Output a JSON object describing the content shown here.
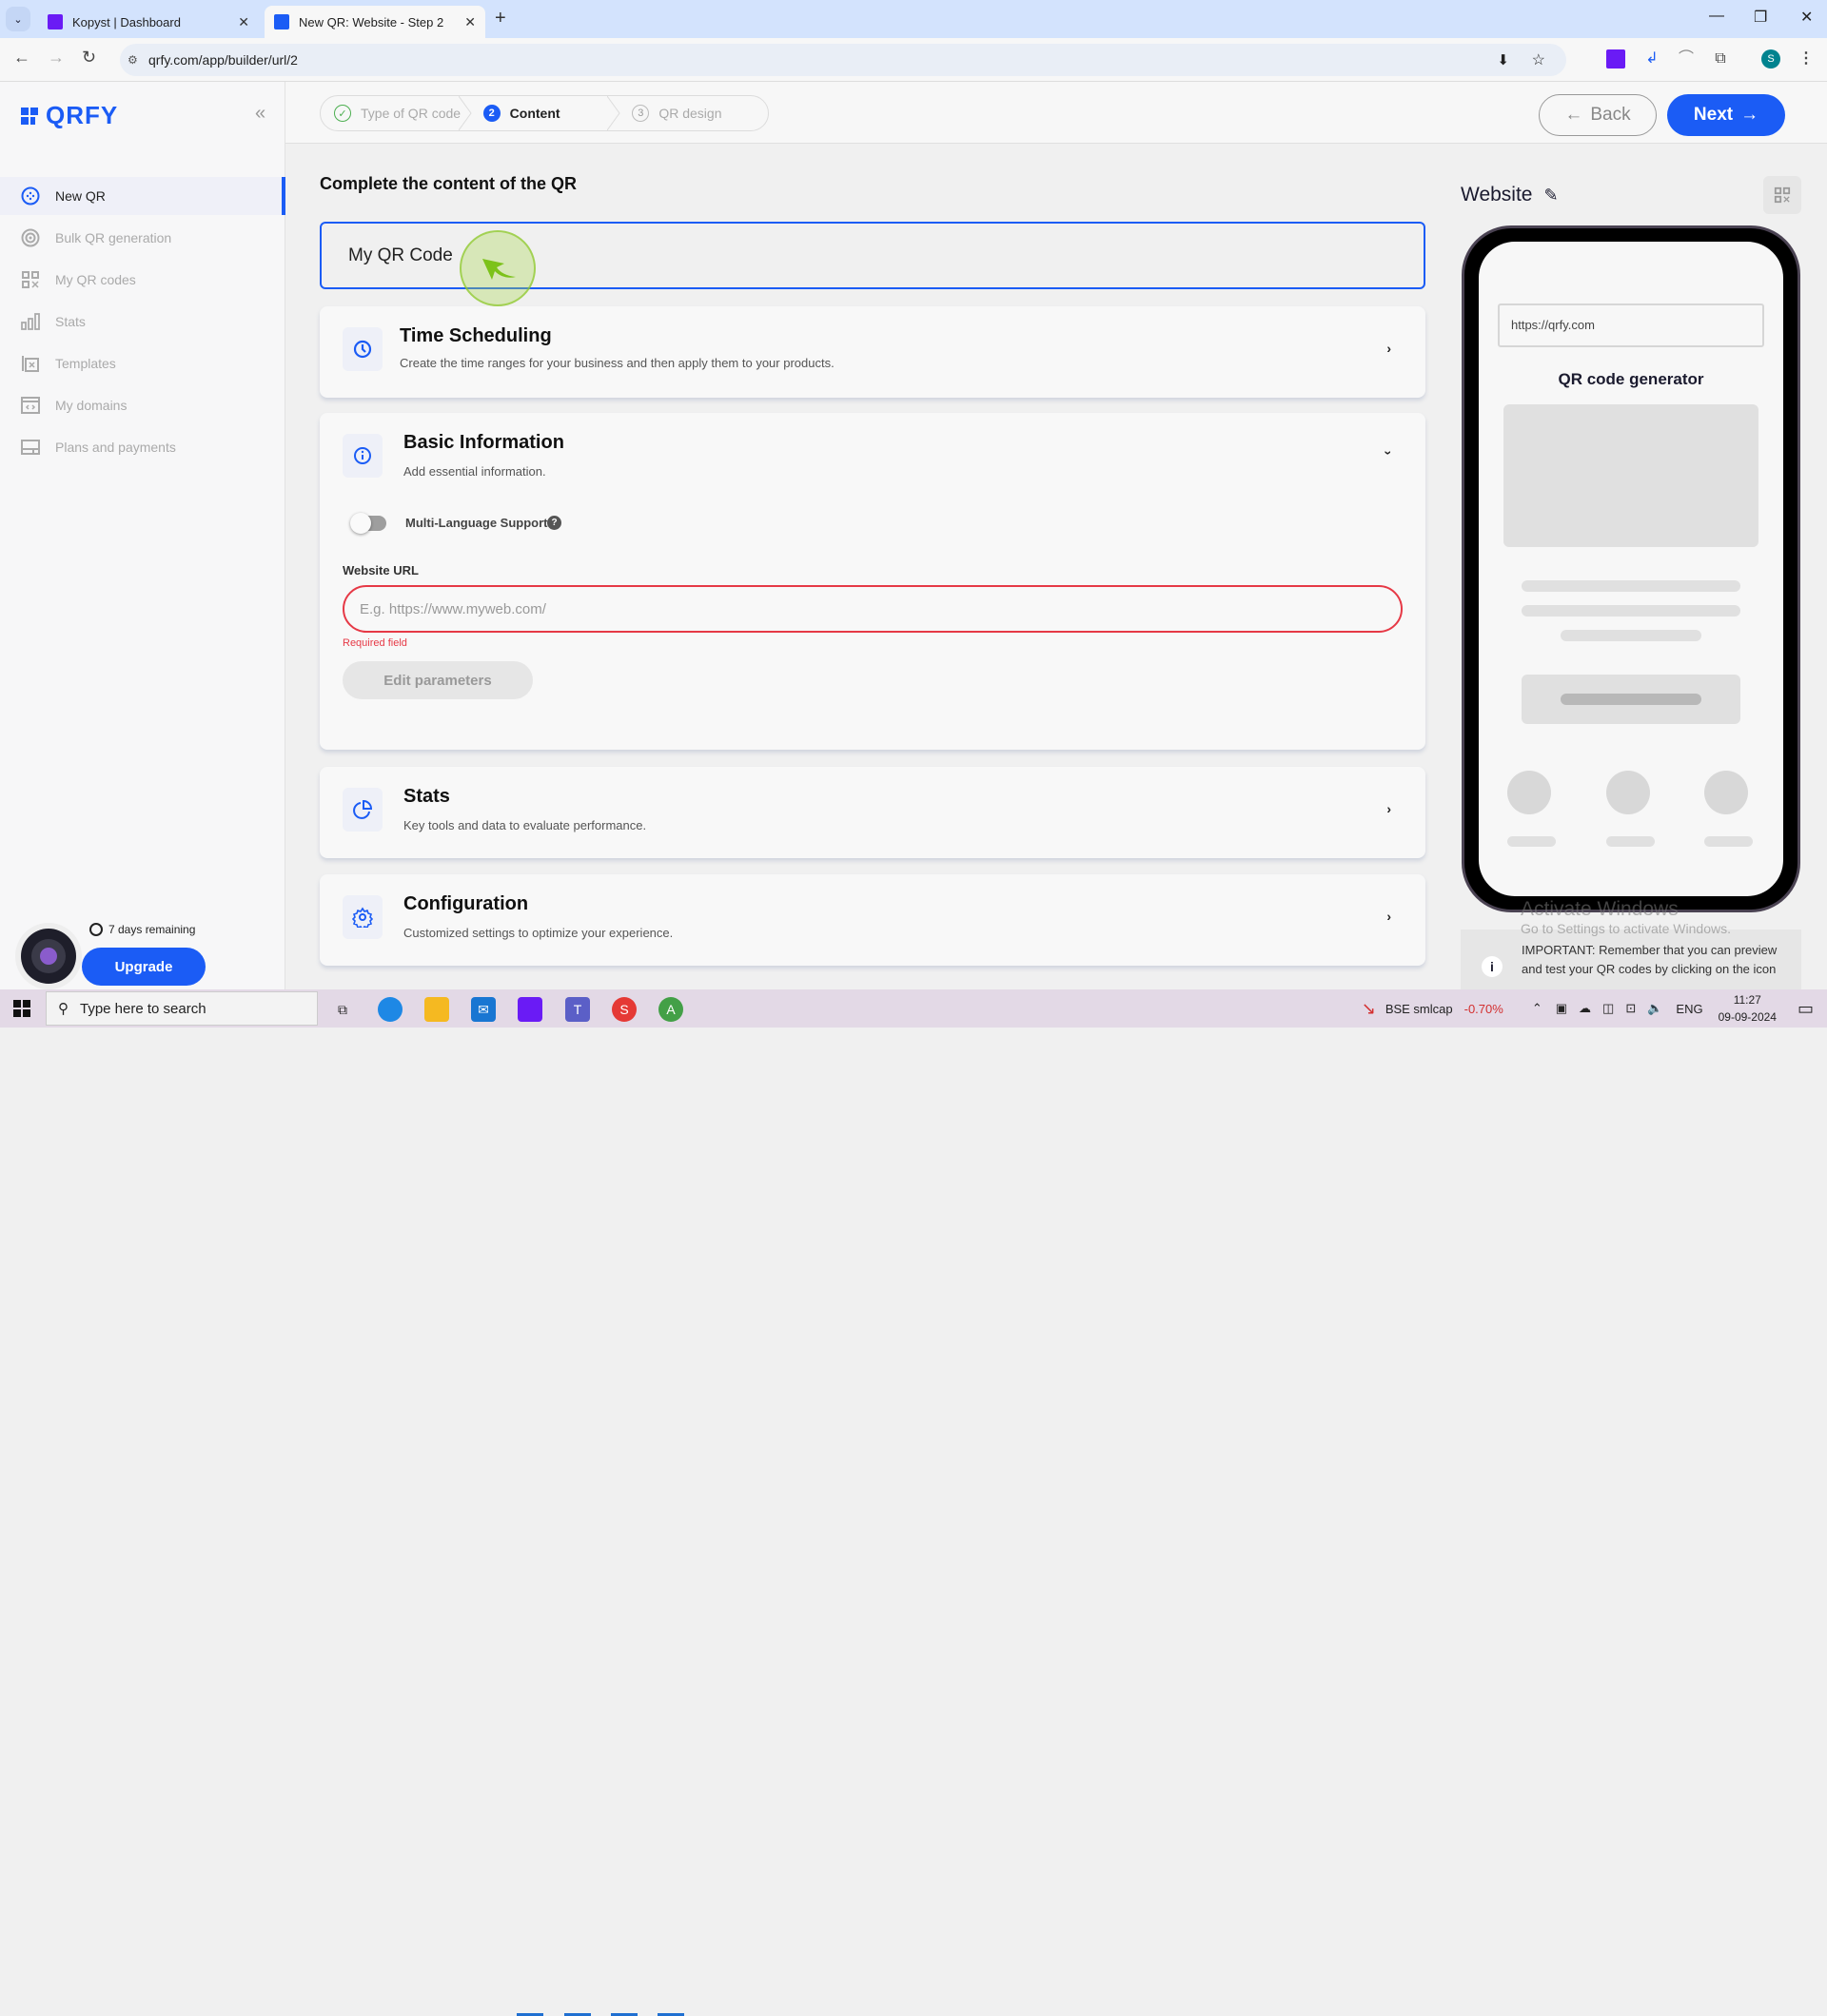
{
  "browser": {
    "tabs": [
      {
        "title": "Kopyst | Dashboard",
        "active": false
      },
      {
        "title": "New QR: Website - Step 2",
        "active": true
      }
    ],
    "url": "qrfy.com/app/builder/url/2",
    "profile_initial": "S"
  },
  "sidebar": {
    "logo": "QRFY",
    "items": [
      {
        "label": "New QR",
        "icon": "plus-circle-icon",
        "active": true
      },
      {
        "label": "Bulk QR generation",
        "icon": "target-icon",
        "active": false
      },
      {
        "label": "My QR codes",
        "icon": "qr-grid-icon",
        "active": false
      },
      {
        "label": "Stats",
        "icon": "bar-chart-icon",
        "active": false
      },
      {
        "label": "Templates",
        "icon": "template-icon",
        "active": false
      },
      {
        "label": "My domains",
        "icon": "domain-icon",
        "active": false
      },
      {
        "label": "Plans and payments",
        "icon": "card-icon",
        "active": false
      }
    ],
    "trial": {
      "remaining": "7 days remaining",
      "upgrade_label": "Upgrade"
    }
  },
  "stepper": {
    "steps": [
      {
        "num": "✓",
        "label": "Type of QR code",
        "state": "done"
      },
      {
        "num": "2",
        "label": "Content",
        "state": "current"
      },
      {
        "num": "3",
        "label": "QR design",
        "state": "todo"
      }
    ],
    "back_label": "Back",
    "next_label": "Next"
  },
  "main": {
    "title": "Complete the content of the QR",
    "qr_name_value": "My QR Code",
    "sections": [
      {
        "title": "Time Scheduling",
        "desc": "Create the time ranges for your business and then apply them to your products.",
        "expanded": false
      },
      {
        "title": "Basic Information",
        "desc": "Add essential information.",
        "expanded": true
      },
      {
        "title": "Stats",
        "desc": "Key tools and data to evaluate performance.",
        "expanded": false
      },
      {
        "title": "Configuration",
        "desc": "Customized settings to optimize your experience.",
        "expanded": false
      }
    ],
    "basic": {
      "multilang_label": "Multi-Language Support",
      "multilang_on": false,
      "url_label": "Website URL",
      "url_placeholder": "E.g. https://www.myweb.com/",
      "url_value": "",
      "error": "Required field",
      "edit_params_label": "Edit parameters"
    }
  },
  "preview": {
    "title": "Website",
    "phone_url": "https://qrfy.com",
    "phone_title": "QR code generator",
    "notice": "IMPORTANT: Remember that you can preview and test your QR codes by clicking on the icon"
  },
  "watermark": {
    "line1": "Activate Windows",
    "line2": "Go to Settings to activate Windows."
  },
  "taskbar": {
    "search_placeholder": "Type here to search",
    "ticker_name": "BSE smlcap",
    "ticker_change": "-0.70%",
    "lang": "ENG",
    "time": "11:27",
    "date": "09-09-2024"
  },
  "colors": {
    "accent": "#1b5cf5",
    "error": "#e63946",
    "success": "#4caf50",
    "ticker_negative": "#d32f2f"
  }
}
